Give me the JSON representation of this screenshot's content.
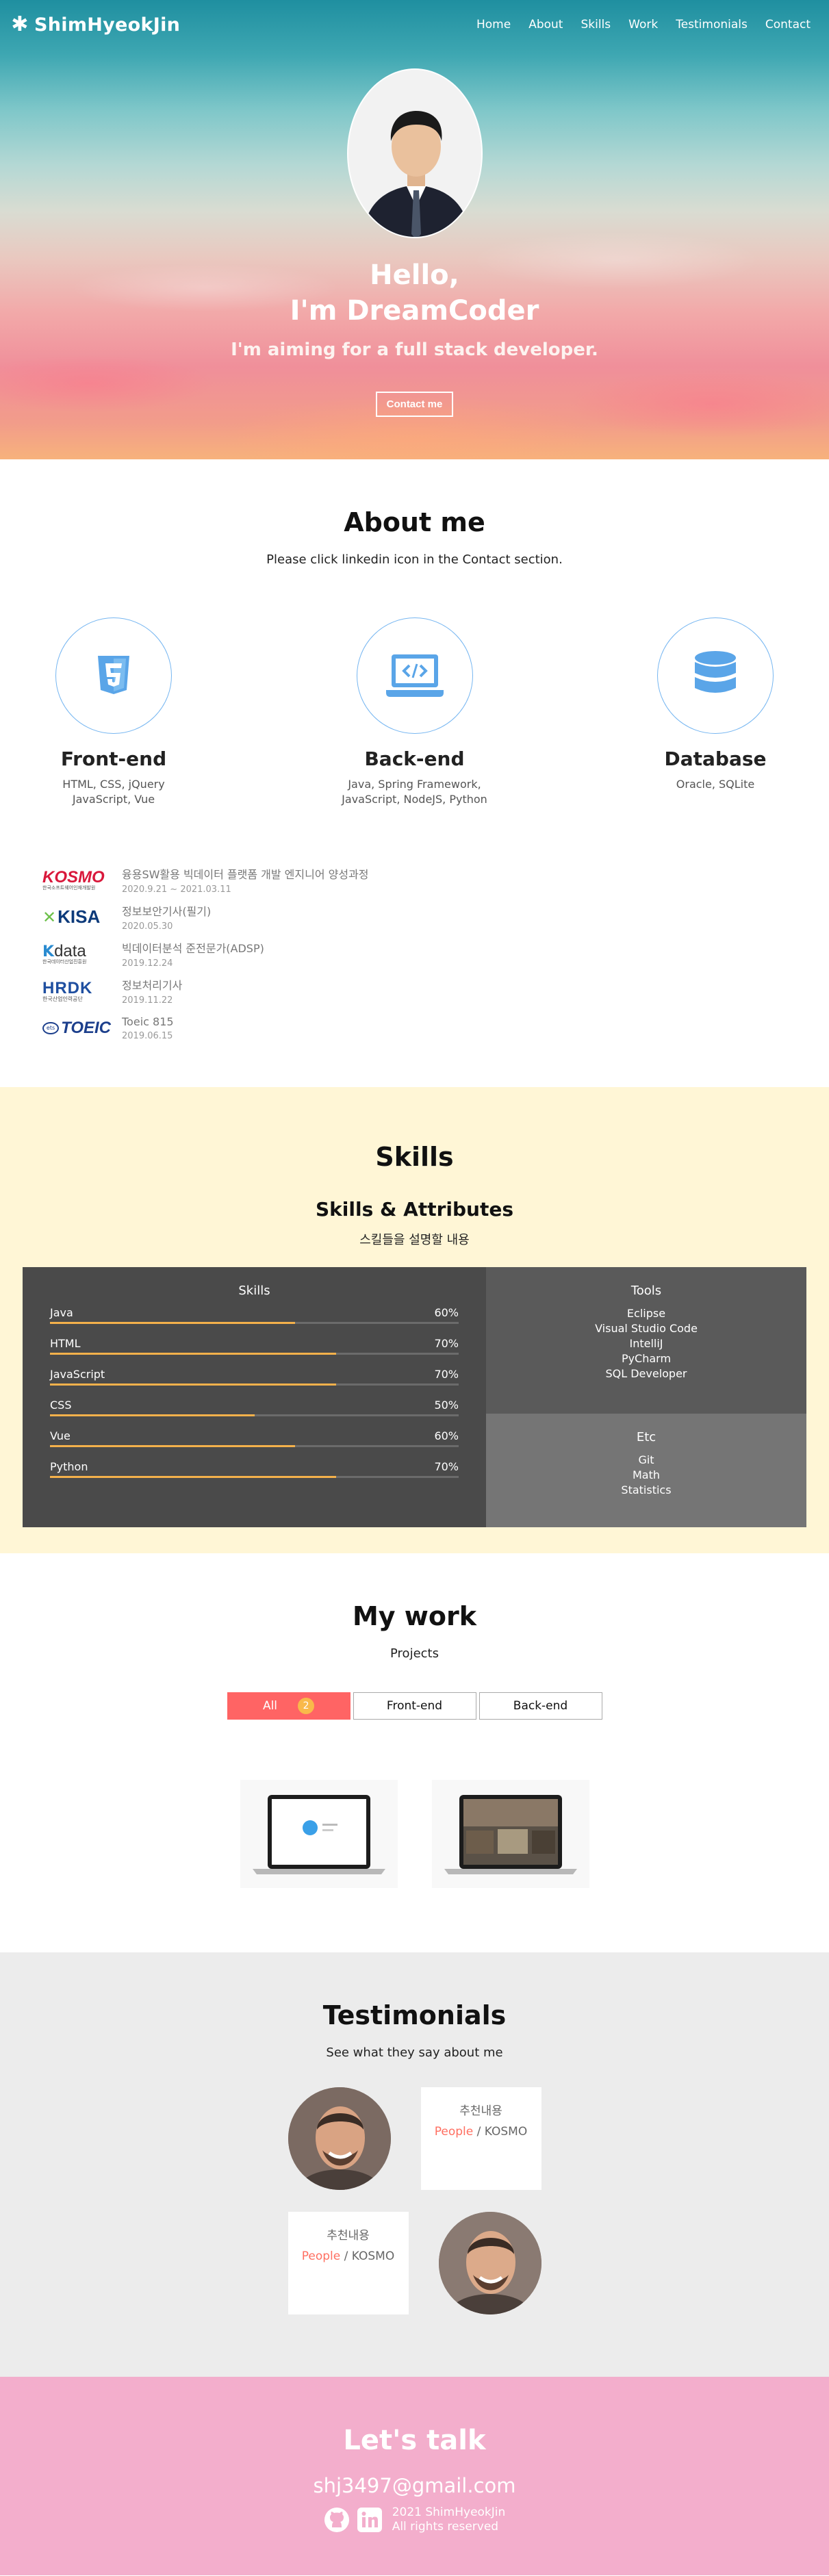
{
  "nav": {
    "logo": "ShimHyeokJin",
    "items": [
      "Home",
      "About",
      "Skills",
      "Work",
      "Testimonials",
      "Contact"
    ]
  },
  "home": {
    "title_line1": "Hello,",
    "title_line2": "I'm DreamCoder",
    "description": "I'm aiming for a full stack developer.",
    "contact_button": "Contact me"
  },
  "about": {
    "title": "About me",
    "description": "Please click linkedin icon in the Contact section.",
    "majors": [
      {
        "icon": "html5-icon",
        "title": "Front-end",
        "desc1": "HTML, CSS, jQuery",
        "desc2": "JavaScript, Vue"
      },
      {
        "icon": "laptop-code-icon",
        "title": "Back-end",
        "desc1": "Java, Spring Framework,",
        "desc2": "JavaScript, NodeJS, Python"
      },
      {
        "icon": "database-icon",
        "title": "Database",
        "desc1": "Oracle, SQLite",
        "desc2": ""
      }
    ],
    "jobs": [
      {
        "logo_text": "KOSMO",
        "logo_sub": "한국소프트웨어인재개발원",
        "name": "융용SW활용 빅데이터 플랫폼 개발 엔지니어 양성과정",
        "period": "2020.9.21 ~ 2021.03.11"
      },
      {
        "logo_text": "KISA",
        "logo_sub": "",
        "name": "정보보안기사(필기)",
        "period": "2020.05.30"
      },
      {
        "logo_text": "data",
        "logo_sub": "한국데이터산업진흥원",
        "name": "빅데이터분석 준전문가(ADSP)",
        "period": "2019.12.24"
      },
      {
        "logo_text": "HRDK",
        "logo_sub": "한국산업인력공단",
        "name": "정보처리기사",
        "period": "2019.11.22"
      },
      {
        "logo_text": "TOEIC",
        "logo_sub": "",
        "name": "Toeic 815",
        "period": "2019.06.15"
      }
    ]
  },
  "skills": {
    "title": "Skills",
    "subtitle": "Skills & Attributes",
    "description": "스킬들을 설명할 내용",
    "coding_title": "Skills",
    "coding": [
      {
        "name": "Java",
        "percent": "60%",
        "value": 60
      },
      {
        "name": "HTML",
        "percent": "70%",
        "value": 70
      },
      {
        "name": "JavaScript",
        "percent": "70%",
        "value": 70
      },
      {
        "name": "CSS",
        "percent": "50%",
        "value": 50
      },
      {
        "name": "Vue",
        "percent": "60%",
        "value": 60
      },
      {
        "name": "Python",
        "percent": "70%",
        "value": 70
      }
    ],
    "tools_title": "Tools",
    "tools": [
      "Eclipse",
      "Visual Studio Code",
      "IntelliJ",
      "PyCharm",
      "SQL Developer"
    ],
    "etc_title": "Etc",
    "etc": [
      "Git",
      "Math",
      "Statistics"
    ],
    "bar_color": "#f4b14b"
  },
  "work": {
    "title": "My work",
    "description": "Projects",
    "categories": [
      {
        "label": "All",
        "count": "2"
      },
      {
        "label": "Front-end"
      },
      {
        "label": "Back-end"
      }
    ]
  },
  "testimonials": {
    "title": "Testimonials",
    "description": "See what they say about me",
    "items": [
      {
        "text": "추천내용",
        "name": "People",
        "company": " / KOSMO"
      },
      {
        "text": "추천내용",
        "name": "People",
        "company": " / KOSMO"
      }
    ]
  },
  "contact": {
    "title": "Let's talk",
    "email": "shj3497@gmail.com",
    "copyright_line1": "2021 ShimHyeokJin",
    "copyright_line2": "All rights reserved"
  },
  "colors": {
    "accent": "#ff6464",
    "skills_bg": "#fff6d6",
    "contact_bg": "#f3aecc",
    "icon_blue": "#5aa5e8"
  }
}
